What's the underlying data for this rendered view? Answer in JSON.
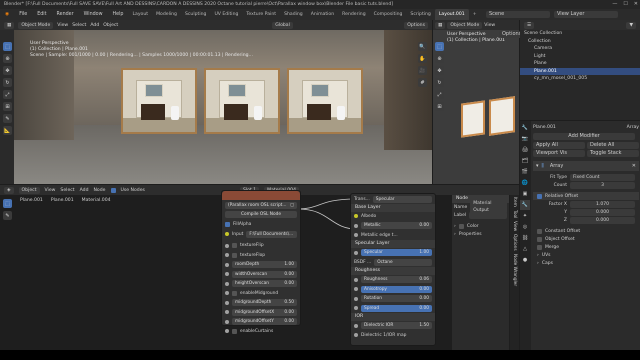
{
  "window": {
    "title": "Blender* [F:\\Full Documents\\Full SAVE SAVE\\Full Art AND DESSINS\\CARDON A DESSINS 2020 Octane tutorial pierre\\Oct\\Parallax window box\\Blender File basic tuts.blend]"
  },
  "menu": {
    "items": [
      "File",
      "Edit",
      "Render",
      "Window",
      "Help"
    ]
  },
  "workspace_tabs": [
    "Layout",
    "Modeling",
    "Sculpting",
    "UV Editing",
    "Texture Paint",
    "Shading",
    "Animation",
    "Rendering",
    "Compositing",
    "Scripting",
    "Layout.001"
  ],
  "active_tab": "Layout.001",
  "top_right": {
    "scene": "Scene",
    "view_layer": "View Layer"
  },
  "viewport": {
    "mode": "Object Mode",
    "menus": [
      "View",
      "Select",
      "Add",
      "Object"
    ],
    "orientation": "Global",
    "options": "Options",
    "overlay_lines": [
      "User Perspective",
      "(1) Collection | Plane.001",
      "Scene | Sample: 001/1000 | 0.00 | Rendering... | Samples 1000/1000 | 00:00:01.13 | Rendering..."
    ]
  },
  "viewport2": {
    "mode": "Object Mode",
    "menus": [
      "View",
      "Select",
      "Add",
      "Object"
    ],
    "options": "Options",
    "overlay_lines": [
      "User Perspective",
      "(1) Collection | Plane.001"
    ]
  },
  "outliner": {
    "items": [
      "Scene Collection",
      "Collection",
      "Camera",
      "Light",
      "Plane",
      "Plane.001",
      "cy_mn_mosel_001_005"
    ],
    "selected_index": 5
  },
  "properties": {
    "object": "Plane.001",
    "modifier_name": "Array",
    "add_modifier": "Add Modifier",
    "buttons": [
      "Apply All",
      "Delete All",
      "Viewport Vis",
      "Toggle Stack"
    ],
    "fit_type_label": "Fit Type",
    "fit_type": "Fixed Count",
    "count_label": "Count",
    "count": "3",
    "relative_offset": "Relative Offset",
    "factor_x": "1.070",
    "factor_y": "0.000",
    "factor_z": "0.000",
    "factor_labels": [
      "Factor X",
      "Y",
      "Z"
    ],
    "collapsed": [
      "Constant Offset",
      "Object Offset",
      "Merge",
      "UVs",
      "Caps"
    ]
  },
  "node_editor": {
    "object_label": "Object",
    "menus": [
      "View",
      "Select",
      "Add",
      "Node"
    ],
    "use_nodes": "Use Nodes",
    "slot": "Slot 1",
    "material": "Material.004",
    "breadcrumb": [
      "Plane.001",
      "Plane.001",
      "Material.004"
    ]
  },
  "osl_node": {
    "header": "",
    "script": "(Parallax room OSL script...",
    "compile": "Compile OSL Node",
    "input_label": "Input",
    "input_value": "F:\\Full Documents\\...",
    "fill_alpha": "FillAlpha",
    "rows": [
      {
        "label": "textureFlip",
        "value": ""
      },
      {
        "label": "textureFlop",
        "value": ""
      },
      {
        "label": "roomDepth",
        "value": "1.00"
      },
      {
        "label": "widthOverscan",
        "value": "0.00"
      },
      {
        "label": "heightOverscan",
        "value": "0.00"
      },
      {
        "label": "enableMidground",
        "value": ""
      },
      {
        "label": "midgroundDepth",
        "value": "0.50"
      },
      {
        "label": "midgroundOffsetX",
        "value": "0.00"
      },
      {
        "label": "midgroundOffsetY",
        "value": "0.00"
      },
      {
        "label": "enableCurtains",
        "value": ""
      }
    ]
  },
  "octane_node": {
    "trans_label": "Trans...",
    "trans_value": "Specular",
    "base_layer": "Base Layer",
    "albedo": "Albedo",
    "metallic": "Metallic",
    "metallic_value": "0.00",
    "metallic_edge": "Metallic edge t...",
    "specular_layer": "Specular Layer",
    "specular": "Specular",
    "specular_value": "1.00",
    "bsdf_label": "BSDF ...",
    "bsdf_value": "Octane",
    "roughness_section": "Roughness",
    "roughness": "Roughness",
    "roughness_value": "0.06",
    "anisotropy": "Anisotropy",
    "anisotropy_value": "0.00",
    "rotation": "Rotation",
    "rotation_value": "0.00",
    "spread": "Spread",
    "spread_value": "0.00",
    "ior_section": "IOR",
    "dielectric_ior": "Dielectric IOR",
    "dielectric_ior_value": "1.50",
    "dielectric_map": "Dielectric 1/IOR map"
  },
  "node_sidebar": {
    "section": "Node",
    "name_label": "Name",
    "name_value": "Material Output",
    "label_label": "Label",
    "color": "Color",
    "properties": "Properties",
    "tabs": [
      "Item",
      "Tool",
      "View",
      "Options",
      "Node Wrangler"
    ]
  },
  "colors": {
    "accent": "#4772b3",
    "node_header": "#8a4a36",
    "wood": "#a57b4a"
  }
}
